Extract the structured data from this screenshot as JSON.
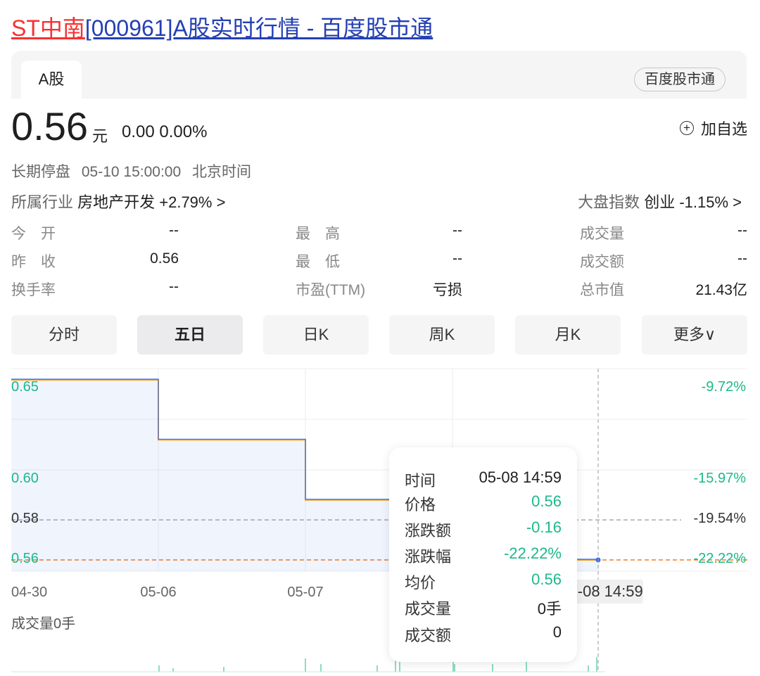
{
  "page": {
    "title_red": "ST中南",
    "title_rest": "[000961]A股实时行情 - 百度股市通"
  },
  "tabs": {
    "a_share": "A股",
    "brand": "百度股市通"
  },
  "quote": {
    "price": "0.56",
    "unit": "元",
    "change": "0.00 0.00%",
    "add_favorite": "加自选",
    "status": "长期停盘",
    "datetime": "05-10 15:00:00",
    "timezone": "北京时间"
  },
  "industry": {
    "label": "所属行业",
    "value": "房地产开发 +2.79% >"
  },
  "market_index": {
    "label": "大盘指数",
    "value": "创业 -1.15% >"
  },
  "stats": {
    "open_label": "今　开",
    "open": "--",
    "prev_close_label": "昨　收",
    "prev_close": "0.56",
    "turnover_label": "换手率",
    "turnover": "--",
    "high_label": "最　高",
    "high": "--",
    "low_label": "最　低",
    "low": "--",
    "pe_label": "市盈(TTM)",
    "pe": "亏损",
    "volume_label": "成交量",
    "volume": "--",
    "amount_label": "成交额",
    "amount": "--",
    "market_cap_label": "总市值",
    "market_cap": "21.43亿"
  },
  "periods": [
    "分时",
    "五日",
    "日K",
    "周K",
    "月K",
    "更多∨"
  ],
  "active_period": "五日",
  "chart_data": {
    "type": "line",
    "title": "",
    "x": [
      "04-30",
      "05-06",
      "05-07",
      "05-08",
      "05-08 14:59"
    ],
    "series": [
      {
        "values": [
          0.65,
          0.65,
          0.62,
          0.62,
          0.59,
          0.59,
          0.56,
          0.56,
          0.56
        ],
        "color": "#3a6ee8"
      }
    ],
    "step_x": [
      0,
      1,
      1,
      2,
      2,
      3,
      3,
      3.8,
      4
    ],
    "ylim": [
      0.54,
      0.66
    ],
    "y_tick_labels_left": [
      "0.65",
      "0.60",
      "0.58",
      "0.56"
    ],
    "y_tick_values_left": [
      0.65,
      0.6,
      0.58,
      0.56
    ],
    "y_tick_labels_right": [
      "-9.72%",
      "-15.97%",
      "-19.54%",
      "-22.22%"
    ],
    "reference_lines": [
      {
        "value": 0.58,
        "color": "#aaaaaa",
        "style": "dashed"
      },
      {
        "value": 0.56,
        "color": "#f07d22",
        "style": "dashed"
      }
    ],
    "x_tick_labels": [
      "04-30",
      "05-06",
      "05-07",
      "05-08"
    ],
    "crosshair_label": "05-08 14:59",
    "colors": {
      "up": "#f73131",
      "down": "#1cb98a",
      "line": "#3a6ee8",
      "avg": "#f0a020"
    }
  },
  "tooltip": {
    "time_label": "时间",
    "time": "05-08 14:59",
    "price_label": "价格",
    "price": "0.56",
    "change_label": "涨跌额",
    "change": "-0.16",
    "pct_label": "涨跌幅",
    "pct": "-22.22%",
    "avg_label": "均价",
    "avg": "0.56",
    "volume_label": "成交量",
    "volume": "0手",
    "amount_label": "成交额",
    "amount": "0"
  },
  "volume_label": "成交量0手"
}
